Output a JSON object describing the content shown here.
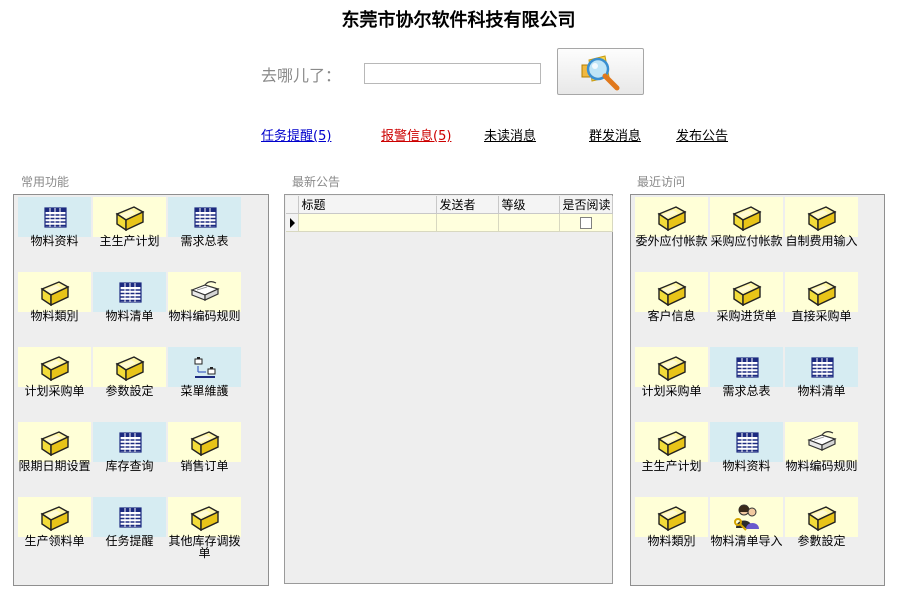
{
  "app": {
    "title": "东莞市协尔软件科技有限公司"
  },
  "search": {
    "label": "去哪儿了：",
    "value": "",
    "button_icon": "magnifier-icon"
  },
  "toplinks": [
    {
      "label": "任务提醒(5)",
      "color": "#0000cc"
    },
    {
      "label": "报警信息(5)",
      "color": "#cc0000"
    },
    {
      "label": "未读消息",
      "color": "#000000"
    },
    {
      "label": "群发消息",
      "color": "#000000"
    },
    {
      "label": "发布公告",
      "color": "#000000"
    }
  ],
  "common": {
    "section_label": "常用功能",
    "tiles": [
      {
        "label": "物料资料",
        "icon": "table-icon"
      },
      {
        "label": "主生产计划",
        "icon": "folder-icon"
      },
      {
        "label": "需求总表",
        "icon": "table-icon"
      },
      {
        "label": "物料類別",
        "icon": "folder-icon"
      },
      {
        "label": "物料清单",
        "icon": "table-icon"
      },
      {
        "label": "物料编码规则",
        "icon": "book-icon"
      },
      {
        "label": "计划采购单",
        "icon": "folder-icon"
      },
      {
        "label": "参数設定",
        "icon": "folder-icon"
      },
      {
        "label": "菜單維護",
        "icon": "menu-tree-icon"
      },
      {
        "label": "限期日期设置",
        "icon": "folder-icon"
      },
      {
        "label": "库存查询",
        "icon": "table-icon"
      },
      {
        "label": "销售订单",
        "icon": "folder-icon"
      },
      {
        "label": "生产领料单",
        "icon": "folder-icon"
      },
      {
        "label": "任务提醒",
        "icon": "table-icon"
      },
      {
        "label": "其他库存调拨单",
        "icon": "folder-icon"
      }
    ]
  },
  "notices": {
    "section_label": "最新公告",
    "columns": [
      "标题",
      "发送者",
      "等级",
      "是否阅读"
    ],
    "rows": [
      {
        "title": "",
        "sender": "",
        "level": "",
        "read": false
      }
    ]
  },
  "recent": {
    "section_label": "最近访问",
    "tiles": [
      {
        "label": "委外应付帐款",
        "icon": "folder-icon"
      },
      {
        "label": "采购应付帐款",
        "icon": "folder-icon"
      },
      {
        "label": "自制费用输入",
        "icon": "folder-icon"
      },
      {
        "label": "客户信息",
        "icon": "folder-icon"
      },
      {
        "label": "采购进货单",
        "icon": "folder-icon"
      },
      {
        "label": "直接采购单",
        "icon": "folder-icon"
      },
      {
        "label": "计划采购单",
        "icon": "folder-icon"
      },
      {
        "label": "需求总表",
        "icon": "table-icon"
      },
      {
        "label": "物料清单",
        "icon": "table-icon"
      },
      {
        "label": "主生产计划",
        "icon": "folder-icon"
      },
      {
        "label": "物料资料",
        "icon": "table-icon"
      },
      {
        "label": "物料编码规则",
        "icon": "book-icon"
      },
      {
        "label": "物料類別",
        "icon": "folder-icon"
      },
      {
        "label": "物料清单导入",
        "icon": "users-key-icon"
      },
      {
        "label": "参數設定",
        "icon": "folder-icon"
      }
    ]
  },
  "colors": {
    "tile_blue": "#d6ecf2",
    "tile_yellow": "#ffffd7",
    "row_yellow": "#ffffdd",
    "panel_bg": "#eeeeee"
  }
}
